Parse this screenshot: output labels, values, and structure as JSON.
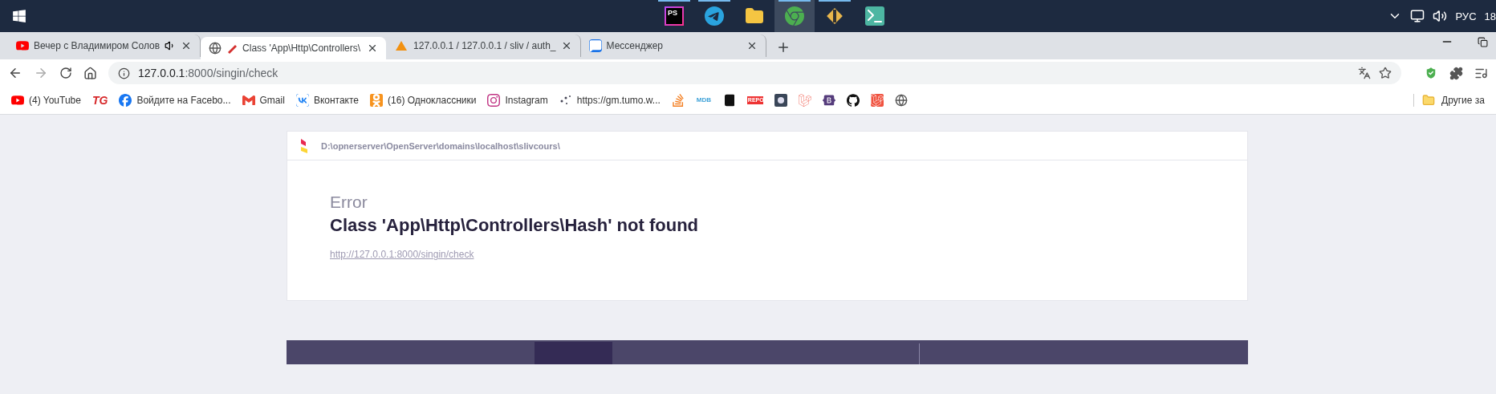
{
  "taskbar": {
    "apps": [
      {
        "badge": "PS",
        "running": true,
        "selected": false
      },
      {
        "running": true,
        "selected": false
      },
      {
        "running": false,
        "selected": false
      },
      {
        "running": true,
        "selected": true
      },
      {
        "running": true,
        "selected": false
      },
      {
        "running": false,
        "selected": false
      }
    ],
    "language": "РУС",
    "clock": "18"
  },
  "tabs": [
    {
      "title": "Вечер с Владимиром Солов",
      "selected": false,
      "audio": true
    },
    {
      "title": "Class 'App\\Http\\Controllers\\",
      "selected": true,
      "audio": false
    },
    {
      "title": "127.0.0.1 / 127.0.0.1 / sliv / auth_",
      "selected": false,
      "audio": false
    },
    {
      "title": "Мессенджер",
      "selected": false,
      "audio": false
    }
  ],
  "address": {
    "host": "127.0.0.1",
    "path": ":8000/singin/check"
  },
  "bookmarks": [
    {
      "kind": "link",
      "label": "(4) YouTube"
    },
    {
      "kind": "icon",
      "badge": "TG"
    },
    {
      "kind": "link",
      "label": "Войдите на Facebo..."
    },
    {
      "kind": "link",
      "label": "Gmail"
    },
    {
      "kind": "link",
      "label": "Вконтакте"
    },
    {
      "kind": "link",
      "label": "(16) Одноклассники"
    },
    {
      "kind": "link",
      "label": "Instagram"
    },
    {
      "kind": "link",
      "label": "https://gm.tumo.w..."
    },
    {
      "kind": "icon"
    },
    {
      "kind": "icon",
      "badge": "MDB"
    },
    {
      "kind": "icon"
    },
    {
      "kind": "icon",
      "badge": "REPO"
    },
    {
      "kind": "icon"
    },
    {
      "kind": "icon"
    },
    {
      "kind": "icon"
    },
    {
      "kind": "icon"
    },
    {
      "kind": "icon"
    },
    {
      "kind": "icon"
    }
  ],
  "other_bookmarks": "Другие за",
  "error_page": {
    "path": "D:\\opnerserver\\OpenServer\\domains\\localhost\\slivcours\\",
    "label": "Error",
    "message": "Class 'App\\Http\\Controllers\\Hash' not found",
    "url": "http://127.0.0.1:8000/singin/check"
  }
}
